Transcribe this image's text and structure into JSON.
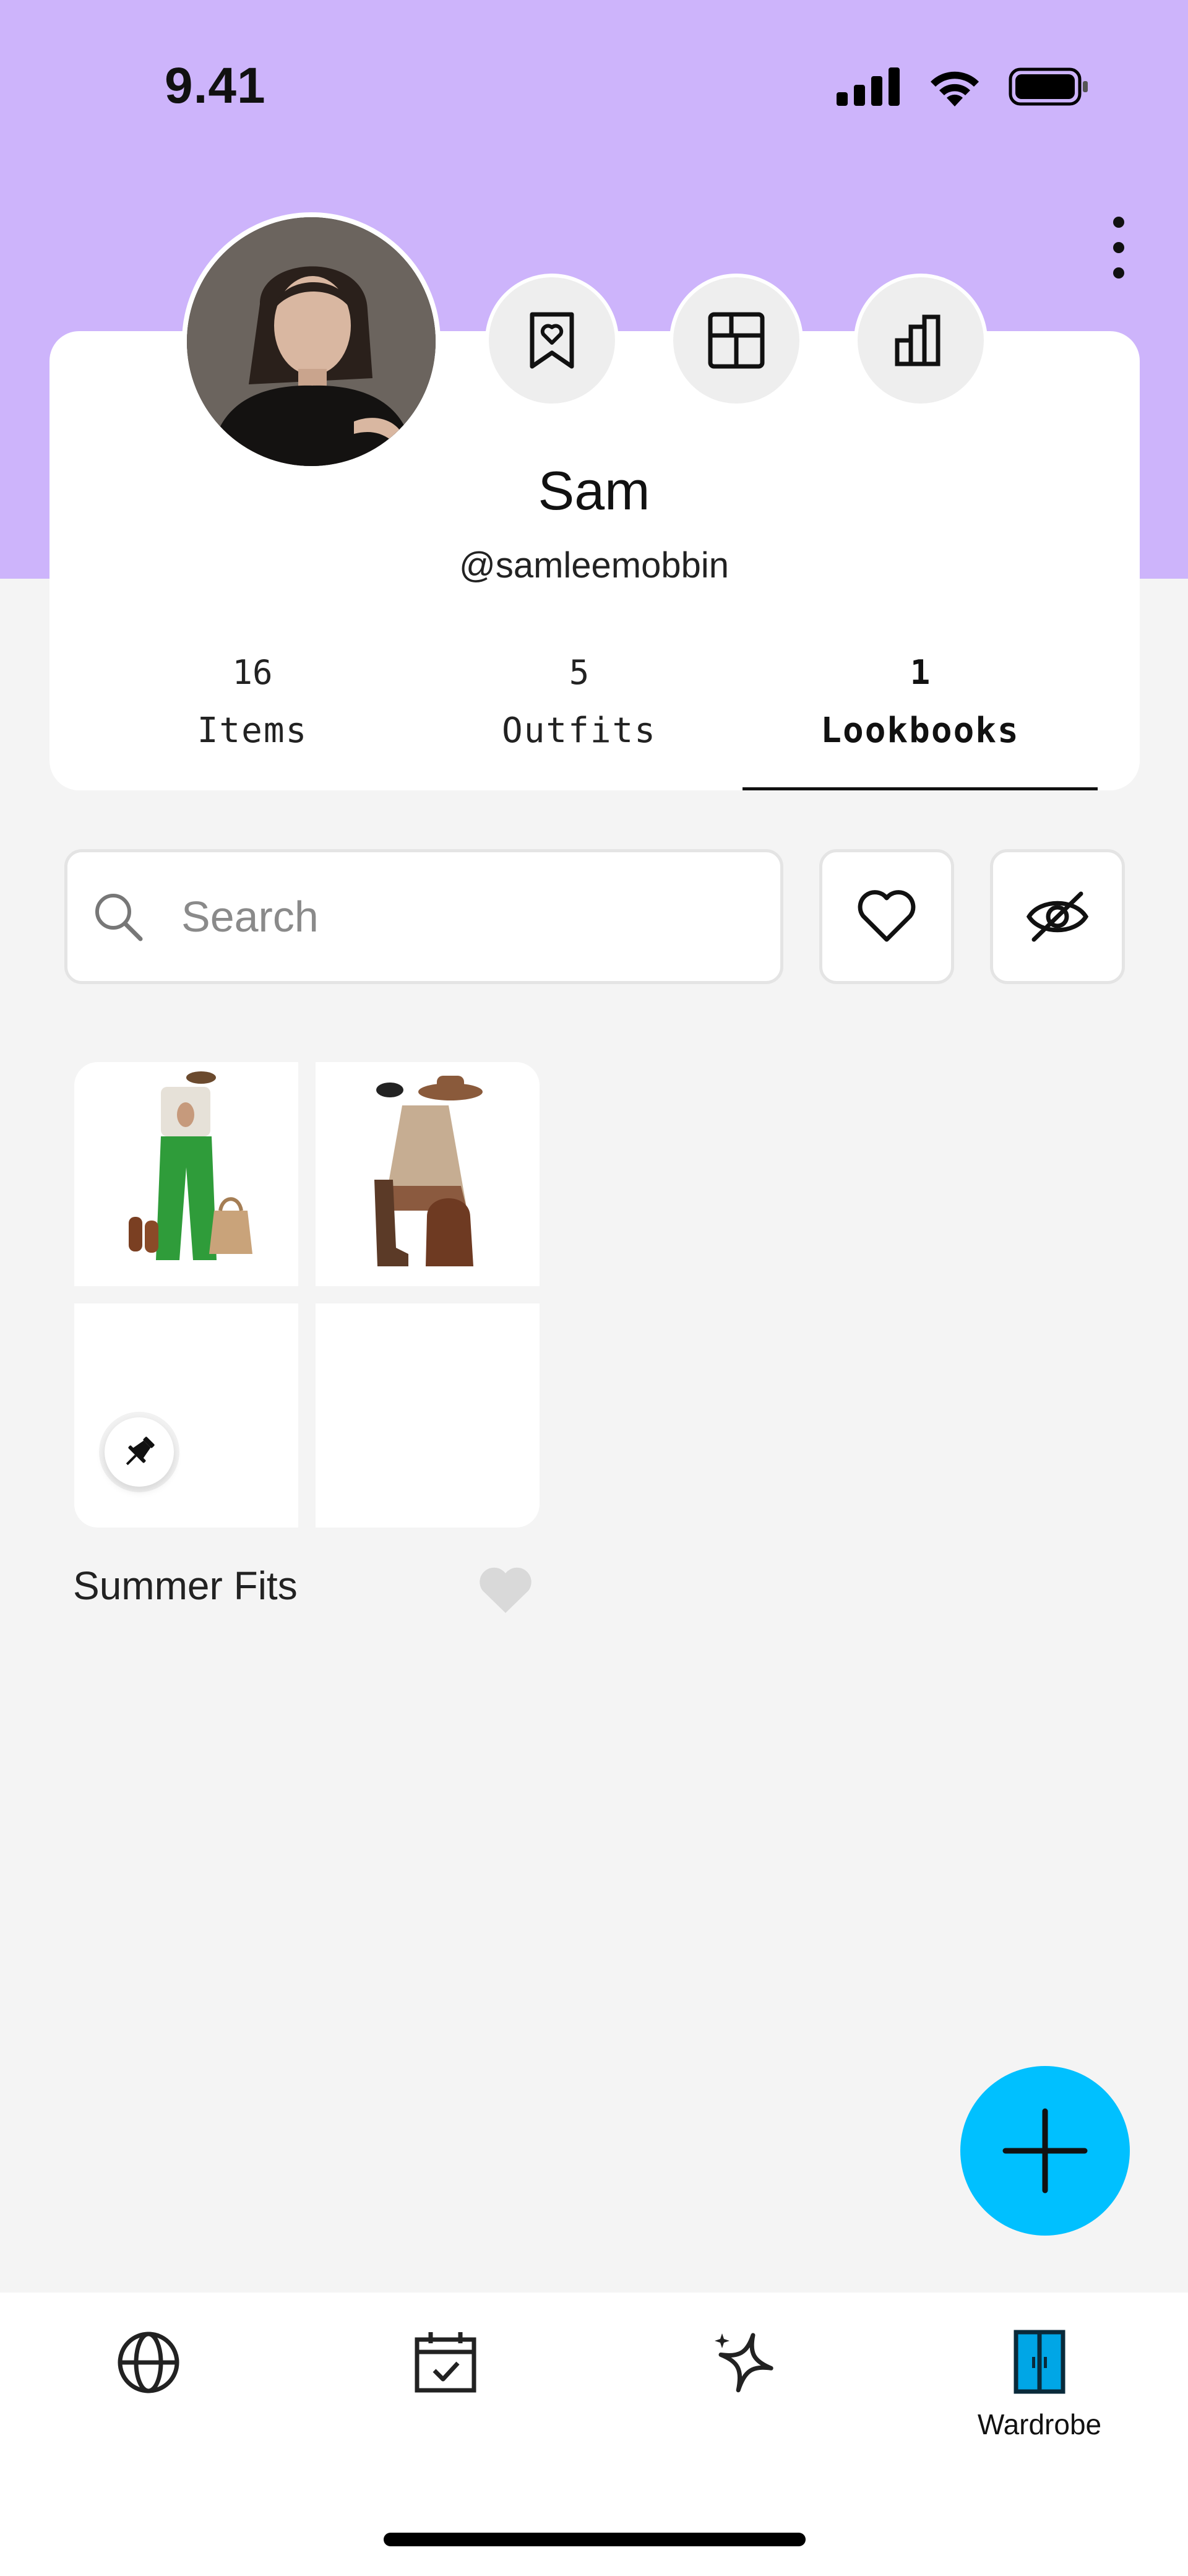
{
  "status_bar": {
    "time": "9.41"
  },
  "profile": {
    "name": "Sam",
    "handle": "@samleemobbin",
    "stats": [
      {
        "value": "16",
        "label": "Items"
      },
      {
        "value": "5",
        "label": "Outfits"
      },
      {
        "value": "1",
        "label": "Lookbooks"
      }
    ],
    "active_tab": "Lookbooks"
  },
  "quick_actions": [
    "bookmark-heart-icon",
    "layout-grid-icon",
    "bar-chart-icon"
  ],
  "search": {
    "placeholder": "Search"
  },
  "lookbooks": [
    {
      "title": "Summer Fits",
      "pinned": true,
      "favorited": false
    }
  ],
  "bottom_nav": [
    {
      "icon": "globe-icon",
      "label": ""
    },
    {
      "icon": "calendar-check-icon",
      "label": ""
    },
    {
      "icon": "sparkle-icon",
      "label": ""
    },
    {
      "icon": "wardrobe-icon",
      "label": "Wardrobe",
      "active": true
    }
  ],
  "colors": {
    "header": "#cdb4fb",
    "accent": "#00c0ff",
    "background": "#f4f4f4"
  }
}
